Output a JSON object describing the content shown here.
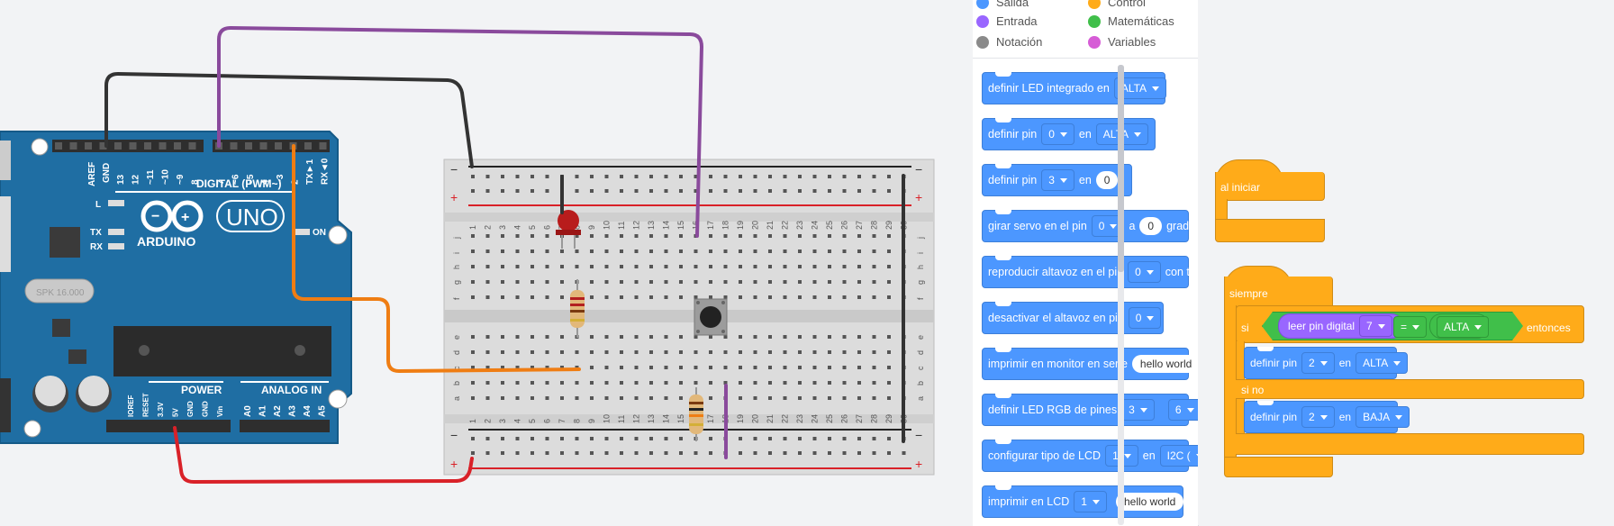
{
  "categories": [
    {
      "label": "Salida",
      "color": "#4c97ff"
    },
    {
      "label": "Control",
      "color": "#ffab19"
    },
    {
      "label": "Entrada",
      "color": "#9966ff"
    },
    {
      "label": "Matemáticas",
      "color": "#40bf4a"
    },
    {
      "label": "Notación",
      "color": "#8a8a8a"
    },
    {
      "label": "Variables",
      "color": "#d65cd6"
    }
  ],
  "palette": {
    "b1": {
      "text": "definir LED integrado en",
      "dd": "ALTA"
    },
    "b2": {
      "t1": "definir pin",
      "dd1": "0",
      "t2": "en",
      "dd2": "ALTA"
    },
    "b3": {
      "t1": "definir pin",
      "dd1": "3",
      "t2": "en",
      "pill": "0"
    },
    "b4": {
      "t1": "girar servo en el pin",
      "dd1": "0",
      "t2": "a",
      "pill": "0",
      "t3": "grad"
    },
    "b5": {
      "t1": "reproducir altavoz en el pin",
      "dd1": "0",
      "t2": "con to"
    },
    "b6": {
      "t1": "desactivar el altavoz en pin",
      "dd1": "0"
    },
    "b7": {
      "t1": "imprimir en monitor en serie",
      "pill": "hello world"
    },
    "b8": {
      "t1": "definir LED RGB de pines",
      "dd1": "3",
      "dd2": "6"
    },
    "b9": {
      "t1": "configurar tipo de LCD",
      "dd1": "1",
      "t2": "en",
      "dd2": "I2C ("
    },
    "b10": {
      "t1": "imprimir en LCD",
      "dd1": "1",
      "pill": "hello world"
    }
  },
  "workspace": {
    "al_iniciar": "al iniciar",
    "siempre": "siempre",
    "si": "si",
    "leer": "leer pin digital",
    "leer_pin": "7",
    "op": "=",
    "val": "ALTA",
    "entonces": "entonces",
    "then_block": {
      "t1": "definir pin",
      "dd1": "2",
      "t2": "en",
      "dd2": "ALTA"
    },
    "si_no": "si no",
    "else_block": {
      "t1": "definir pin",
      "dd1": "2",
      "t2": "en",
      "dd2": "BAJA"
    }
  },
  "arduino": {
    "aref": "AREF",
    "gnd": "GND",
    "digital": "DIGITAL (PWM~)",
    "pins_top": [
      "13",
      "12",
      "~11",
      "~10",
      "~9",
      "8",
      "7",
      "~6",
      "~5",
      "4",
      "~3",
      "2",
      "TX►1",
      "RX◄0"
    ],
    "l": "L",
    "tx": "TX",
    "rx": "RX",
    "on": "ON",
    "uno": "UNO",
    "brand": "ARDUINO",
    "crystal": "SPK 16.000",
    "power": "POWER",
    "analog_in": "ANALOG IN",
    "power_pins": [
      "IOREF",
      "RESET",
      "3.3V",
      "5V",
      "GND",
      "GND",
      "Vin"
    ],
    "analog_pins": [
      "A0",
      "A1",
      "A2",
      "A3",
      "A4",
      "A5"
    ]
  },
  "breadboard": {
    "col_numbers": [
      "1",
      "2",
      "3",
      "4",
      "5",
      "6",
      "7",
      "8",
      "9",
      "10",
      "11",
      "12",
      "13",
      "14",
      "15",
      "16",
      "17",
      "18",
      "19",
      "20",
      "21",
      "22",
      "23",
      "24",
      "25",
      "26",
      "27",
      "28",
      "29",
      "30"
    ],
    "rows_top": [
      "j",
      "i",
      "h",
      "g",
      "f"
    ],
    "rows_bottom": [
      "e",
      "d",
      "c",
      "b",
      "a"
    ],
    "minus": "−",
    "plus": "+"
  },
  "colors": {
    "board": "#1f6ea3",
    "wire_black": "#333333",
    "wire_purple": "#8a4a9c",
    "wire_orange": "#ef7d13",
    "wire_red": "#d92128"
  }
}
